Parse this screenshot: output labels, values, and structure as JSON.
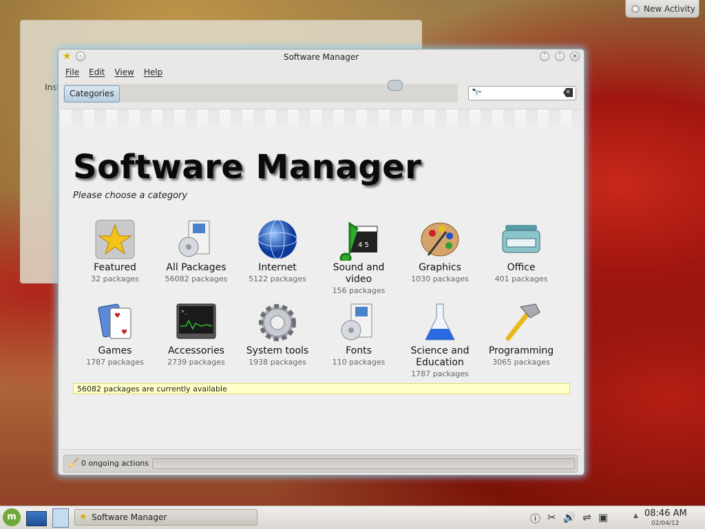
{
  "desktop": {
    "new_activity_label": "New Activity",
    "background_window_text": "Inst"
  },
  "window": {
    "title": "Software Manager",
    "menu": [
      "File",
      "Edit",
      "View",
      "Help"
    ],
    "categories_button": "Categories",
    "search": {
      "value": "",
      "placeholder": ""
    }
  },
  "main": {
    "heading": "Software Manager",
    "subtitle": "Please choose a category",
    "categories": [
      {
        "name": "Featured",
        "count": "32 packages",
        "icon": "featured-star-icon"
      },
      {
        "name": "All Packages",
        "count": "56082 packages",
        "icon": "package-box-icon"
      },
      {
        "name": "Internet",
        "count": "5122 packages",
        "icon": "globe-icon"
      },
      {
        "name": "Sound and video",
        "count": "156 packages",
        "icon": "music-clapper-icon"
      },
      {
        "name": "Graphics",
        "count": "1030 packages",
        "icon": "palette-icon"
      },
      {
        "name": "Office",
        "count": "401 packages",
        "icon": "typewriter-icon"
      },
      {
        "name": "Games",
        "count": "1787 packages",
        "icon": "playing-cards-icon"
      },
      {
        "name": "Accessories",
        "count": "2739 packages",
        "icon": "terminal-icon"
      },
      {
        "name": "System tools",
        "count": "1938 packages",
        "icon": "gear-icon"
      },
      {
        "name": "Fonts",
        "count": "110 packages",
        "icon": "package-box-icon"
      },
      {
        "name": "Science and Education",
        "count": "1787 packages",
        "icon": "flask-icon"
      },
      {
        "name": "Programming",
        "count": "3065 packages",
        "icon": "hammer-icon"
      }
    ],
    "status_text": "56082 packages are currently available"
  },
  "statusbar": {
    "actions_text": "0 ongoing actions"
  },
  "taskbar": {
    "task_label": "Software Manager",
    "time": "08:46 AM",
    "date": "02/04/12"
  }
}
